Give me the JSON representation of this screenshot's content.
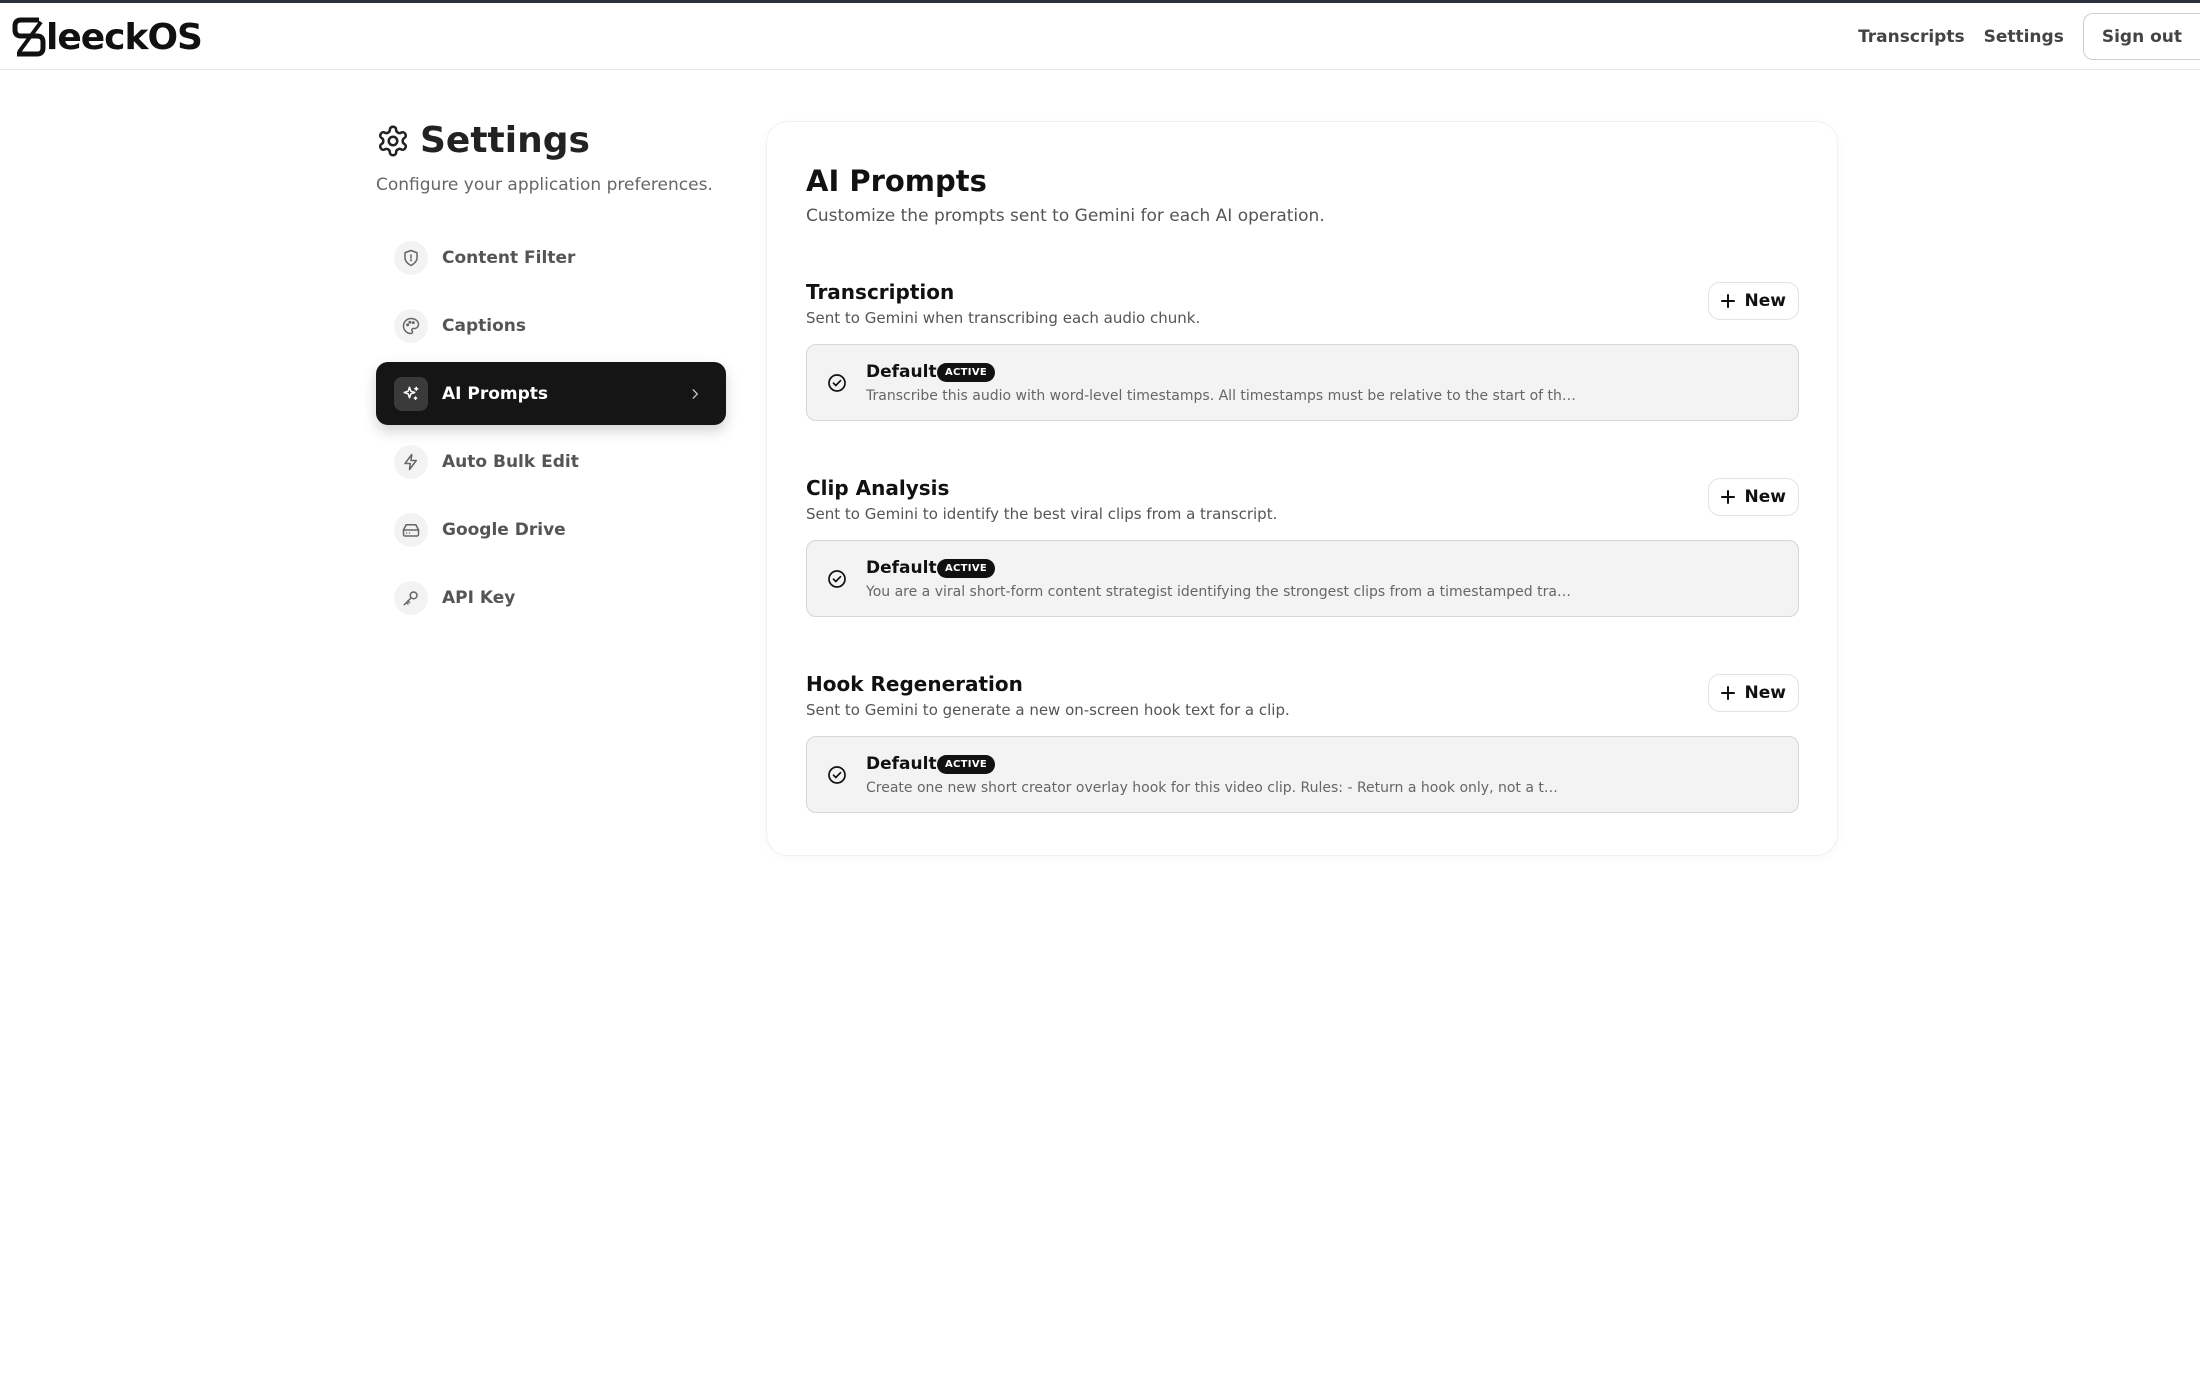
{
  "header": {
    "logo_text": "leeckOS",
    "nav": [
      "Transcripts",
      "Settings"
    ],
    "signout_label": "Sign out"
  },
  "settings": {
    "title": "Settings",
    "subtitle": "Configure your application preferences."
  },
  "sidebar": {
    "items": [
      {
        "label": "Content Filter",
        "icon": "shield-icon"
      },
      {
        "label": "Captions",
        "icon": "palette-icon"
      },
      {
        "label": "AI Prompts",
        "icon": "sparkles-icon",
        "active": true
      },
      {
        "label": "Auto Bulk Edit",
        "icon": "lightning-icon"
      },
      {
        "label": "Google Drive",
        "icon": "drive-icon"
      },
      {
        "label": "API Key",
        "icon": "key-icon"
      }
    ]
  },
  "panel": {
    "title": "AI Prompts",
    "subtitle": "Customize the prompts sent to Gemini for each AI operation.",
    "new_label": "New",
    "sections": [
      {
        "title": "Transcription",
        "subtitle": "Sent to Gemini when transcribing each audio chunk.",
        "prompt": {
          "name": "Default",
          "badge": "ACTIVE",
          "preview": "Transcribe this audio with word-level timestamps. All timestamps must be relative to the start of th…"
        }
      },
      {
        "title": "Clip Analysis",
        "subtitle": "Sent to Gemini to identify the best viral clips from a transcript.",
        "prompt": {
          "name": "Default",
          "badge": "ACTIVE",
          "preview": "You are a viral short-form content strategist identifying the strongest clips from a timestamped tra…"
        }
      },
      {
        "title": "Hook Regeneration",
        "subtitle": "Sent to Gemini to generate a new on-screen hook text for a clip.",
        "prompt": {
          "name": "Default",
          "badge": "ACTIVE",
          "preview": "Create one new short creator overlay hook for this video clip. Rules: - Return a hook only, not a t…"
        }
      }
    ]
  },
  "colors": {
    "accent": "#151515",
    "card_bg": "#f3f3f3",
    "card_border": "#d6d6d6"
  }
}
